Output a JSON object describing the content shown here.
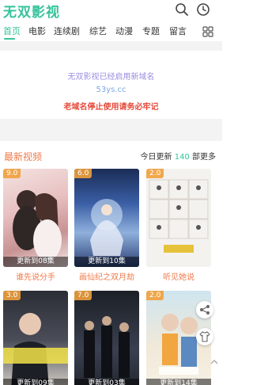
{
  "app": {
    "title": "无双影视"
  },
  "header": {
    "icons": [
      "search-icon",
      "history-icon"
    ]
  },
  "nav": {
    "items": [
      {
        "label": "首页"
      },
      {
        "label": "电影"
      },
      {
        "label": "连续剧"
      },
      {
        "label": "综艺"
      },
      {
        "label": "动漫"
      },
      {
        "label": "专题"
      },
      {
        "label": "留言"
      }
    ],
    "grid_icon": "grid-icon"
  },
  "notice": {
    "line1": "无双影视已经启用新域名",
    "line2": "53ys.cc",
    "line3": "老域名停止使用请务必牢记"
  },
  "section": {
    "title": "最新视频",
    "more_prefix": "今日更新",
    "count": "140",
    "more_suffix": "部更多"
  },
  "videos": [
    {
      "score": "9.0",
      "status": "更新到08集",
      "title": "谁先说分手"
    },
    {
      "score": "6.0",
      "status": "更新到10集",
      "title": "画仙纪之双月劫"
    },
    {
      "score": "2.0",
      "status": "",
      "title": "听见她说"
    },
    {
      "score": "3.0",
      "status": "更新到09集",
      "title": ""
    },
    {
      "score": "7.0",
      "status": "更新到03集",
      "title": ""
    },
    {
      "score": "2.0",
      "status": "更新到14集",
      "title": ""
    }
  ],
  "colors": {
    "accent": "#35c39b",
    "highlight": "#f07a4a",
    "warning": "#e64a3a"
  }
}
